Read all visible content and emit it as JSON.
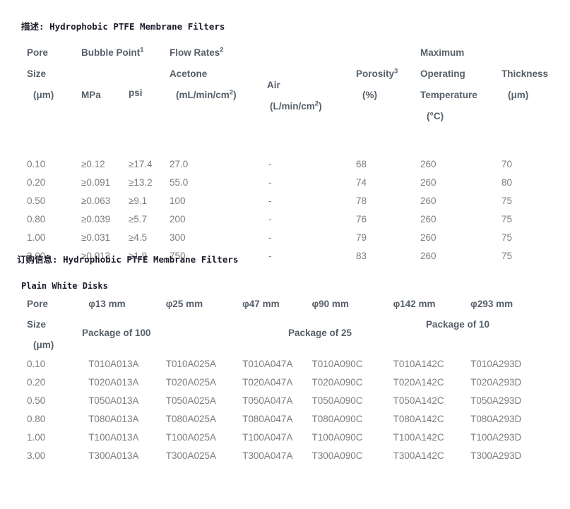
{
  "page": {
    "description_heading_cjk": "描述",
    "description_heading_rest": ": Hydrophobic PTFE Membrane Filters",
    "ordering_heading_cjk": "订购信息",
    "ordering_heading_rest": ": Hydrophobic PTFE Membrane Filters",
    "subsection_title": "Plain White Disks",
    "colors": {
      "background": "#ffffff",
      "heading_text": "#1b1b2b",
      "table_header_text": "#57606a",
      "table_cell_text": "#7d7d7d"
    }
  },
  "specs_table": {
    "headers": {
      "pore_line1": "Pore",
      "pore_line2": "Size",
      "pore_line3": "(μm)",
      "bubble_point": "Bubble Point",
      "bubble_point_sup": "1",
      "mpa": "MPa",
      "psi": "psi",
      "flow_rates": "Flow Rates",
      "flow_rates_sup": "2",
      "acetone": "Acetone",
      "acetone_units_pre": "(mL/min/cm",
      "acetone_units_sup": "2",
      "acetone_units_post": ")",
      "air": "Air",
      "air_units_pre": "(L/min/cm",
      "air_units_sup": "2",
      "air_units_post": ")",
      "porosity": "Porosity",
      "porosity_sup": "3",
      "porosity_units": "(%)",
      "max_op_line1": "Maximum",
      "max_op_line2": "Operating",
      "max_op_line3": "Temperature",
      "max_op_line4": "(°C)",
      "thickness": "Thickness",
      "thickness_units": "(μm)"
    },
    "rows": [
      {
        "pore": "0.10",
        "mpa": "≥0.12",
        "psi": "≥17.4",
        "acetone": "27.0",
        "air": "-",
        "porosity": "68",
        "temperature": "260",
        "thickness": "70"
      },
      {
        "pore": "0.20",
        "mpa": "≥0.091",
        "psi": "≥13.2",
        "acetone": "55.0",
        "air": "-",
        "porosity": "74",
        "temperature": "260",
        "thickness": "80"
      },
      {
        "pore": "0.50",
        "mpa": "≥0.063",
        "psi": "≥9.1",
        "acetone": "100",
        "air": "-",
        "porosity": "78",
        "temperature": "260",
        "thickness": "75"
      },
      {
        "pore": "0.80",
        "mpa": "≥0.039",
        "psi": "≥5.7",
        "acetone": "200",
        "air": "-",
        "porosity": "76",
        "temperature": "260",
        "thickness": "75"
      },
      {
        "pore": "1.00",
        "mpa": "≥0.031",
        "psi": "≥4.5",
        "acetone": "300",
        "air": "-",
        "porosity": "79",
        "temperature": "260",
        "thickness": "75"
      },
      {
        "pore": "3.00",
        "mpa": "≥0.013",
        "psi": "≥1.9",
        "acetone": "750",
        "air": "-",
        "porosity": "83",
        "temperature": "260",
        "thickness": "75"
      }
    ]
  },
  "ordering_table": {
    "headers": {
      "pore_line1": "Pore",
      "pore_line2": "Size",
      "pore_line3": "(μm)",
      "d13": "φ13 mm",
      "d25": "φ25 mm",
      "d47": "φ47 mm",
      "d90": "φ90 mm",
      "d142": "φ142 mm",
      "d293": "φ293 mm",
      "package_100": "Package of 100",
      "package_25": "Package of 25",
      "package_10": "Package of 10"
    },
    "rows": [
      {
        "pore": "0.10",
        "d13": "T010A013A",
        "d25": "T010A025A",
        "d47": "T010A047A",
        "d90": "T010A090C",
        "d142": "T010A142C",
        "d293": "T010A293D"
      },
      {
        "pore": "0.20",
        "d13": "T020A013A",
        "d25": "T020A025A",
        "d47": "T020A047A",
        "d90": "T020A090C",
        "d142": "T020A142C",
        "d293": "T020A293D"
      },
      {
        "pore": "0.50",
        "d13": "T050A013A",
        "d25": "T050A025A",
        "d47": "T050A047A",
        "d90": "T050A090C",
        "d142": "T050A142C",
        "d293": "T050A293D"
      },
      {
        "pore": "0.80",
        "d13": "T080A013A",
        "d25": "T080A025A",
        "d47": "T080A047A",
        "d90": "T080A090C",
        "d142": "T080A142C",
        "d293": "T080A293D"
      },
      {
        "pore": "1.00",
        "d13": "T100A013A",
        "d25": "T100A025A",
        "d47": "T100A047A",
        "d90": "T100A090C",
        "d142": "T100A142C",
        "d293": "T100A293D"
      },
      {
        "pore": "3.00",
        "d13": "T300A013A",
        "d25": "T300A025A",
        "d47": "T300A047A",
        "d90": "T300A090C",
        "d142": "T300A142C",
        "d293": "T300A293D"
      }
    ]
  }
}
